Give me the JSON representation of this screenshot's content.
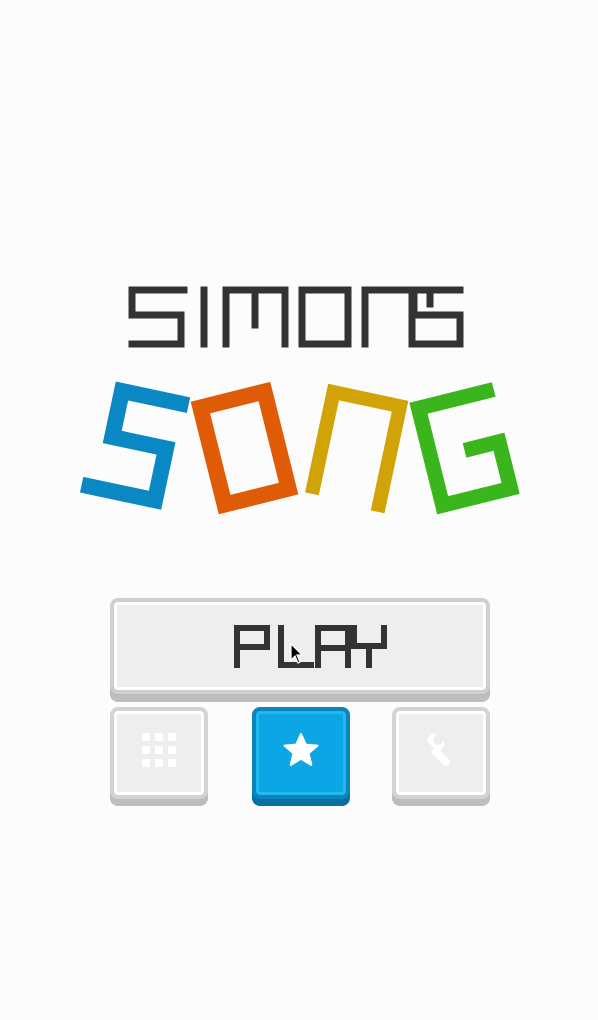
{
  "title": {
    "line1": "SIMON'S",
    "line2": "SONG",
    "line2_letters": [
      {
        "char": "S",
        "color": "#0a88c3"
      },
      {
        "char": "O",
        "color": "#e05b06"
      },
      {
        "char": "N",
        "color": "#d2a307"
      },
      {
        "char": "G",
        "color": "#3bb51c"
      }
    ],
    "line1_color": "#333333"
  },
  "menu": {
    "play_label": "PLAY",
    "buttons": [
      {
        "name": "levels",
        "icon": "grid-icon",
        "selected": false
      },
      {
        "name": "favorites",
        "icon": "star-icon",
        "selected": true
      },
      {
        "name": "settings",
        "icon": "wrench-icon",
        "selected": false
      }
    ]
  },
  "colors": {
    "background": "#fcfcfc",
    "button_face": "#eeeeee",
    "button_border": "#cfcfcf",
    "accent": "#0ba6e3"
  }
}
